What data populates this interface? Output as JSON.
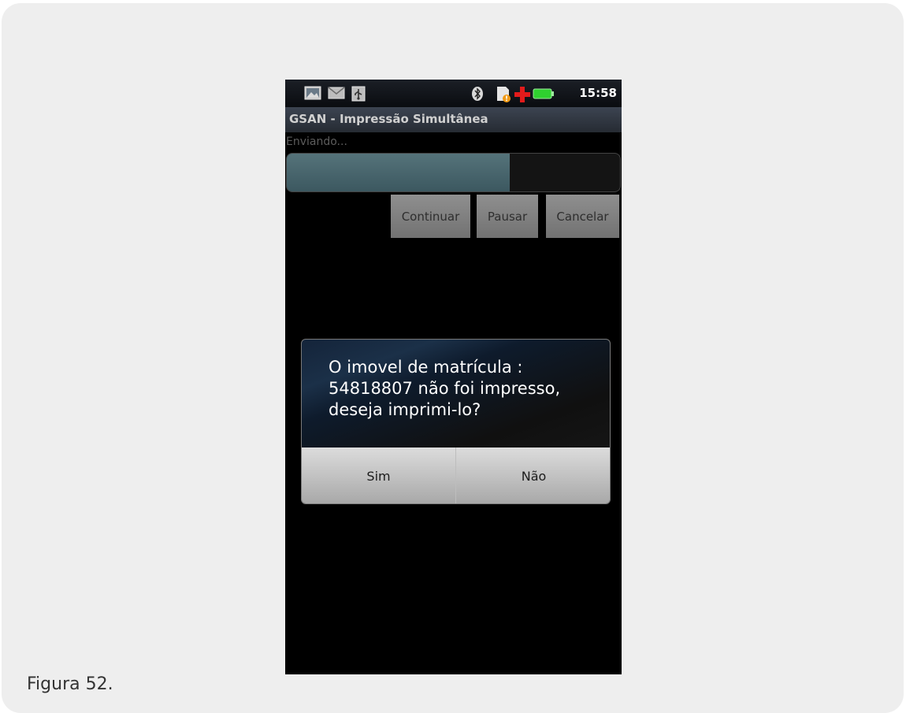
{
  "figure": {
    "caption": "Figura 52."
  },
  "status_bar": {
    "time": "15:58",
    "icons": [
      "image-notification-icon",
      "mail-icon",
      "usb-icon",
      "bluetooth-icon",
      "sd-card-warning-icon",
      "medical-cross-icon",
      "battery-icon"
    ],
    "battery_color": "#2fd12f",
    "cross_color": "#e21b1b"
  },
  "app": {
    "title": "GSAN - Impressão Simultânea",
    "status_label": "Enviando...",
    "progress_fraction": 0.67,
    "buttons": {
      "continuar": "Continuar",
      "pausar": "Pausar",
      "cancelar": "Cancelar"
    }
  },
  "dialog": {
    "message": "O imovel de matrícula : 54818807 não foi impresso, deseja imprimi-lo?",
    "buttons": {
      "yes": "Sim",
      "no": "Não"
    }
  }
}
